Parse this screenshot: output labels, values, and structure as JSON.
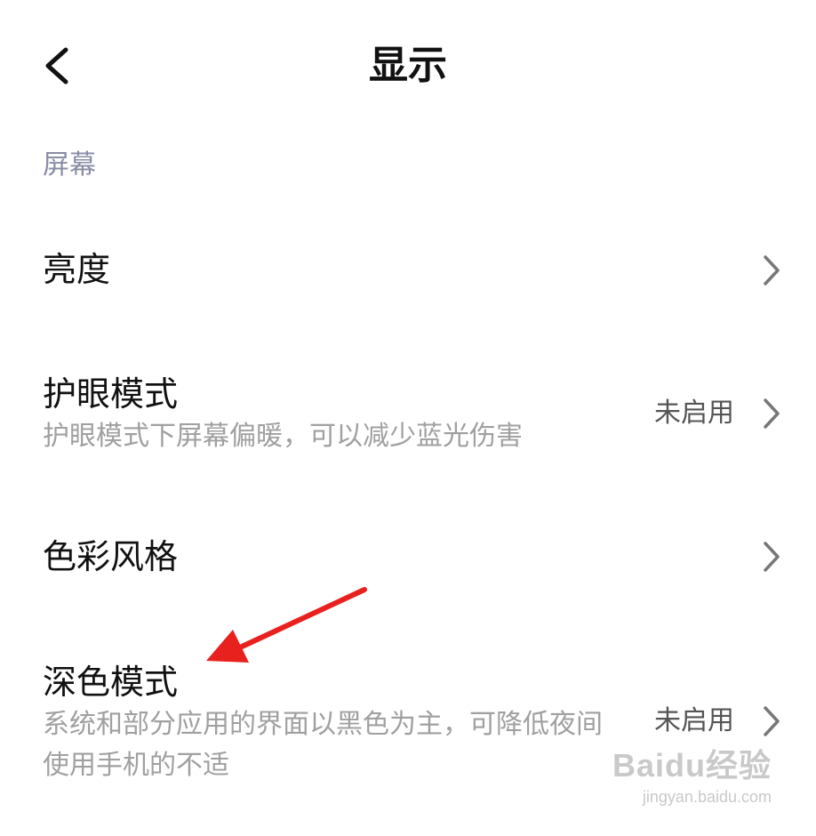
{
  "header": {
    "title": "显示",
    "back_icon": "chevron-left-icon"
  },
  "section": {
    "label": "屏幕"
  },
  "rows": [
    {
      "title": "亮度",
      "subtitle": "",
      "status": ""
    },
    {
      "title": "护眼模式",
      "subtitle": "护眼模式下屏幕偏暖，可以减少蓝光伤害",
      "status": "未启用"
    },
    {
      "title": "色彩风格",
      "subtitle": "",
      "status": ""
    },
    {
      "title": "深色模式",
      "subtitle": "系统和部分应用的界面以黑色为主，可降低夜间使用手机的不适",
      "status": "未启用"
    }
  ],
  "annotation": {
    "type": "red-arrow",
    "color": "#e8201e",
    "points_to": "深色模式"
  },
  "watermark": {
    "brand": "Baidu经验",
    "url": "jingyan.baidu.com"
  }
}
